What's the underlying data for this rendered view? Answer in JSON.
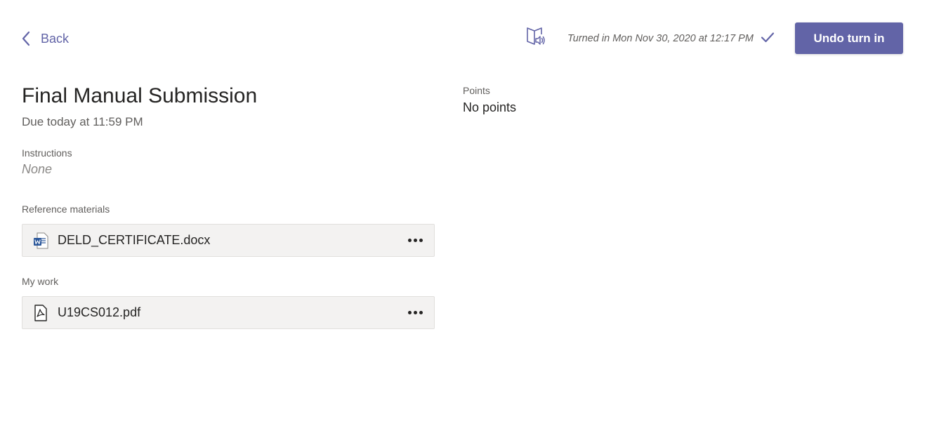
{
  "header": {
    "back_label": "Back",
    "turned_in_text": "Turned in Mon Nov 30, 2020 at 12:17 PM",
    "undo_button_label": "Undo turn in",
    "icons": {
      "back": "chevron-left-icon",
      "reader": "immersive-reader-icon",
      "status": "checkmark-icon"
    }
  },
  "assignment": {
    "title": "Final Manual Submission",
    "due": "Due today at 11:59 PM",
    "instructions_label": "Instructions",
    "instructions_value": "None",
    "reference_label": "Reference materials",
    "reference_files": [
      {
        "name": "DELD_CERTIFICATE.docx",
        "icon": "word-file-icon"
      }
    ],
    "my_work_label": "My work",
    "my_work_files": [
      {
        "name": "U19CS012.pdf",
        "icon": "pdf-file-icon"
      }
    ]
  },
  "points": {
    "label": "Points",
    "value": "No points"
  },
  "colors": {
    "accent": "#6264a7",
    "card_background": "#f3f2f1",
    "word_blue": "#2b579a"
  }
}
